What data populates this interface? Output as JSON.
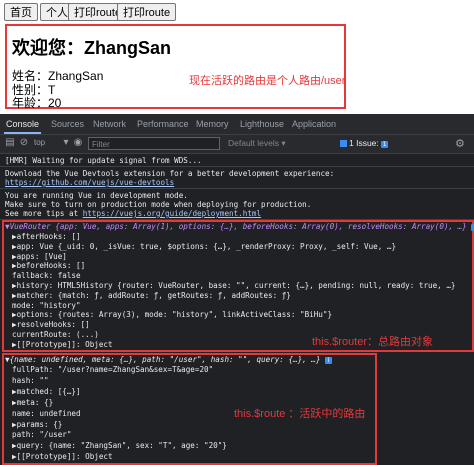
{
  "nav": {
    "home": "首页",
    "personal": "个人",
    "print_router": "打印router",
    "print_route": "打印route"
  },
  "page": {
    "welcome": "欢迎您：ZhangSan",
    "name": "姓名：ZhangSan",
    "sex": "性别：T",
    "age": "年龄：20",
    "note": "现在活跃的路由是个人路由/user"
  },
  "devtools": {
    "tabs": [
      "Console",
      "Sources",
      "Network",
      "Performance",
      "Memory",
      "Lighthouse",
      "Application"
    ],
    "context": "top",
    "filter_placeholder": "Filter",
    "levels": "Default levels ▾",
    "issues": "1 Issue:",
    "issues_count": "1"
  },
  "console": {
    "hmr": "[HMR] Waiting for update signal from WDS...",
    "devtools_msg1": "Download the Vue Devtools extension for a better development experience:",
    "devtools_link": "https://github.com/vuejs/vue-devtools",
    "dev_mode1": "You are running Vue in development mode.",
    "dev_mode2": "Make sure to turn on production mode when deploying for production.",
    "dev_mode3_prefix": "See more tips at ",
    "dev_mode3_link": "https://vuejs.org/guide/deployment.html",
    "router_header": "▼VueRouter {app: Vue, apps: Array(1), options: {…}, beforeHooks: Array(0), resolveHooks: Array(0), …}",
    "router_lines": [
      "▶afterHooks: []",
      "▶app: Vue {_uid: 0, _isVue: true, $options: {…}, _renderProxy: Proxy, _self: Vue, …}",
      "▶apps: [Vue]",
      "▶beforeHooks: []",
      "  fallback: false",
      "▶history: HTML5History {router: VueRouter, base: \"\", current: {…}, pending: null, ready: true, …}",
      "▶matcher: {match: ƒ, addRoute: ƒ, getRoutes: ƒ, addRoutes: ƒ}",
      "  mode: \"history\"",
      "▶options: {routes: Array(3), mode: \"history\", linkActiveClass: \"BiHu\"}",
      "▶resolveHooks: []",
      "  currentRoute: (...)",
      "▶[[Prototype]]: Object"
    ],
    "router_note": "this.$router：总路由对象",
    "route_header": "▼{name: undefined, meta: {…}, path: \"/user\", hash: \"\", query: {…}, …}",
    "route_lines": [
      "  fullPath: \"/user?name=ZhangSan&sex=T&age=20\"",
      "  hash: \"\"",
      "▶matched: [{…}]",
      "▶meta: {}",
      "  name: undefined",
      "▶params: {}",
      "  path: \"/user\"",
      "▶query: {name: \"ZhangSan\", sex: \"T\", age: \"20\"}",
      "▶[[Prototype]]: Object"
    ],
    "route_note": "this.$route ：活跃中的路由"
  }
}
